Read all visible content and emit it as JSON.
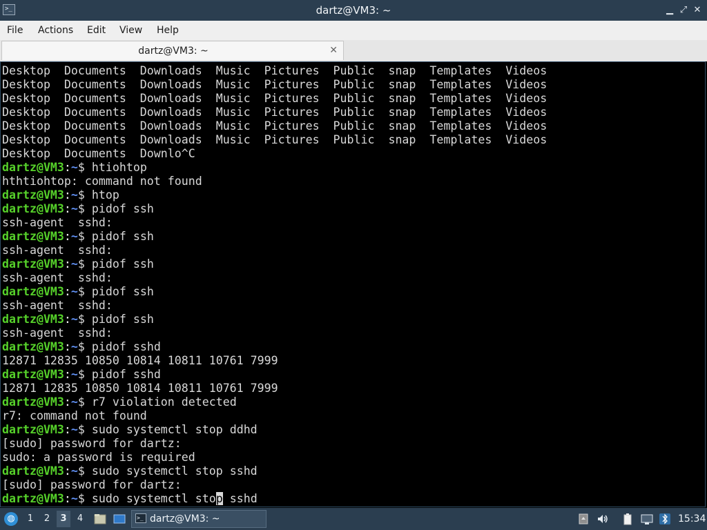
{
  "window": {
    "title": "dartz@VM3: ~",
    "minimize_glyph": "▁",
    "maximize_glyph": "⤢",
    "close_glyph": "✕"
  },
  "menubar": {
    "file": "File",
    "actions": "Actions",
    "edit": "Edit",
    "view": "View",
    "help": "Help"
  },
  "tab": {
    "label": "dartz@VM3: ~",
    "close_glyph": "✕"
  },
  "prompt": {
    "user_host": "dartz@VM3",
    "separator": ":",
    "path": "~",
    "symbol": "$ "
  },
  "terminal": {
    "lines": [
      {
        "type": "output",
        "text": "Desktop  Documents  Downloads  Music  Pictures  Public  snap  Templates  Videos"
      },
      {
        "type": "output",
        "text": "Desktop  Documents  Downloads  Music  Pictures  Public  snap  Templates  Videos"
      },
      {
        "type": "output",
        "text": "Desktop  Documents  Downloads  Music  Pictures  Public  snap  Templates  Videos"
      },
      {
        "type": "output",
        "text": "Desktop  Documents  Downloads  Music  Pictures  Public  snap  Templates  Videos"
      },
      {
        "type": "output",
        "text": "Desktop  Documents  Downloads  Music  Pictures  Public  snap  Templates  Videos"
      },
      {
        "type": "output",
        "text": "Desktop  Documents  Downloads  Music  Pictures  Public  snap  Templates  Videos"
      },
      {
        "type": "output",
        "text": "Desktop  Documents  Downlo^C"
      },
      {
        "type": "prompt",
        "text": "htiohtop"
      },
      {
        "type": "output",
        "text": "hthtiohtop: command not found"
      },
      {
        "type": "prompt",
        "text": "htop"
      },
      {
        "type": "prompt",
        "text": "pidof ssh"
      },
      {
        "type": "output",
        "text": "ssh-agent  sshd:"
      },
      {
        "type": "prompt",
        "text": "pidof ssh"
      },
      {
        "type": "output",
        "text": "ssh-agent  sshd:"
      },
      {
        "type": "prompt",
        "text": "pidof ssh"
      },
      {
        "type": "output",
        "text": "ssh-agent  sshd:"
      },
      {
        "type": "prompt",
        "text": "pidof ssh"
      },
      {
        "type": "output",
        "text": "ssh-agent  sshd:"
      },
      {
        "type": "prompt",
        "text": "pidof ssh"
      },
      {
        "type": "output",
        "text": "ssh-agent  sshd:"
      },
      {
        "type": "prompt",
        "text": "pidof sshd"
      },
      {
        "type": "output",
        "text": "12871 12835 10850 10814 10811 10761 7999"
      },
      {
        "type": "prompt",
        "text": "pidof sshd"
      },
      {
        "type": "output",
        "text": "12871 12835 10850 10814 10811 10761 7999"
      },
      {
        "type": "prompt",
        "text": "r7 violation detected"
      },
      {
        "type": "output",
        "text": "r7: command not found"
      },
      {
        "type": "prompt",
        "text": "sudo systemctl stop ddhd"
      },
      {
        "type": "output",
        "text": "[sudo] password for dartz:"
      },
      {
        "type": "output",
        "text": "sudo: a password is required"
      },
      {
        "type": "prompt",
        "text": "sudo systemctl stop sshd"
      },
      {
        "type": "output",
        "text": "[sudo] password for dartz:"
      },
      {
        "type": "current",
        "before": "sudo systemctl sto",
        "cursor": "p",
        "after": " sshd"
      }
    ]
  },
  "taskbar": {
    "workspaces": [
      "1",
      "2",
      "3",
      "4"
    ],
    "active_workspace": "3",
    "task_label": "dartz@VM3: ~",
    "clock": "15:34",
    "icons": [
      "start-menu-icon",
      "file-manager-icon",
      "desktop-icon",
      "terminal-icon",
      "clipboard-icon",
      "volume-icon",
      "battery-icon",
      "network-icon",
      "bluetooth-icon"
    ]
  }
}
